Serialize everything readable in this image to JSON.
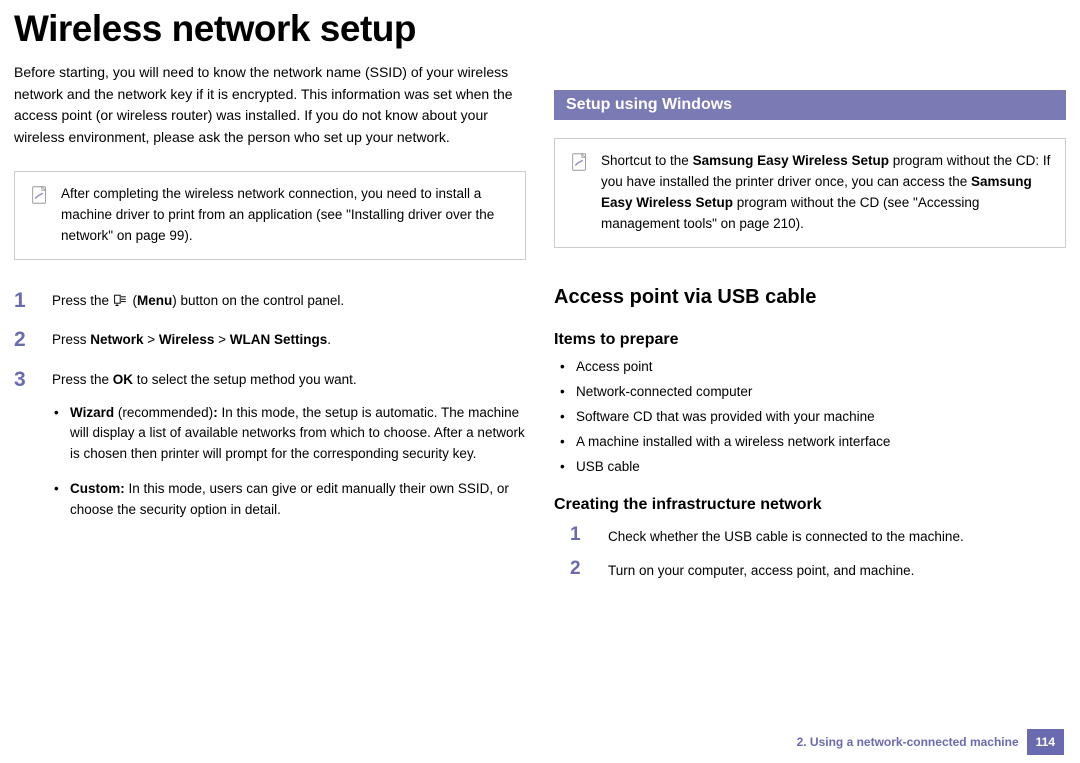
{
  "title": "Wireless network setup",
  "left": {
    "intro": "Before starting, you will need to know the network name (SSID) of your wireless network and the network key if it is encrypted. This information was set when the access point (or wireless router) was installed. If you do not know about your wireless environment, please ask the person who set up your network.",
    "note": "After completing the wireless network connection, you need to install a machine driver to print from an application (see \"Installing driver over the network\" on page 99).",
    "steps": {
      "s1_pre": "Press the ",
      "s1_mid": " (",
      "s1_bold": "Menu",
      "s1_post": ") button on the control panel.",
      "s2_pre": "Press ",
      "s2_net": "Network",
      "s2_gt1": " > ",
      "s2_wireless": "Wireless",
      "s2_gt2": " > ",
      "s2_wlan": "WLAN Settings",
      "s2_end": ".",
      "s3_pre": "Press the ",
      "s3_ok": "OK",
      "s3_post": " to select the setup method you want.",
      "wiz_label": "Wizard",
      "wiz_rec": " (recommended)",
      "wiz_sep": ": ",
      "wiz_body": "In this mode, the setup is automatic. The machine will display a list of available networks from which to choose. After a network is chosen then printer will prompt for the corresponding security key.",
      "cust_label": "Custom",
      "cust_sep": ": ",
      "cust_body": "In this mode, users can give or edit manually their own SSID, or choose the security option in detail."
    }
  },
  "right": {
    "section_bar": "Setup using Windows",
    "note_pre": "Shortcut to the ",
    "note_b1": "Samsung Easy Wireless Setup",
    "note_mid1": " program without the CD: If you have installed the printer driver once, you can access the ",
    "note_b2": "Samsung Easy Wireless Setup",
    "note_post": " program without the CD (see \"Accessing management tools\" on page 210).",
    "h2": "Access point via USB cable",
    "h3a": "Items to prepare",
    "items": [
      "Access point",
      "Network-connected computer",
      "Software CD that was provided with your machine",
      "A machine installed with a wireless network interface",
      "USB cable"
    ],
    "h3b": "Creating the infrastructure network",
    "steps": {
      "s1": "Check whether the USB cable is connected to the machine.",
      "s2": "Turn on your computer, access point, and machine."
    }
  },
  "footer": {
    "chapter": "2.  Using a network-connected machine",
    "page": "114"
  }
}
